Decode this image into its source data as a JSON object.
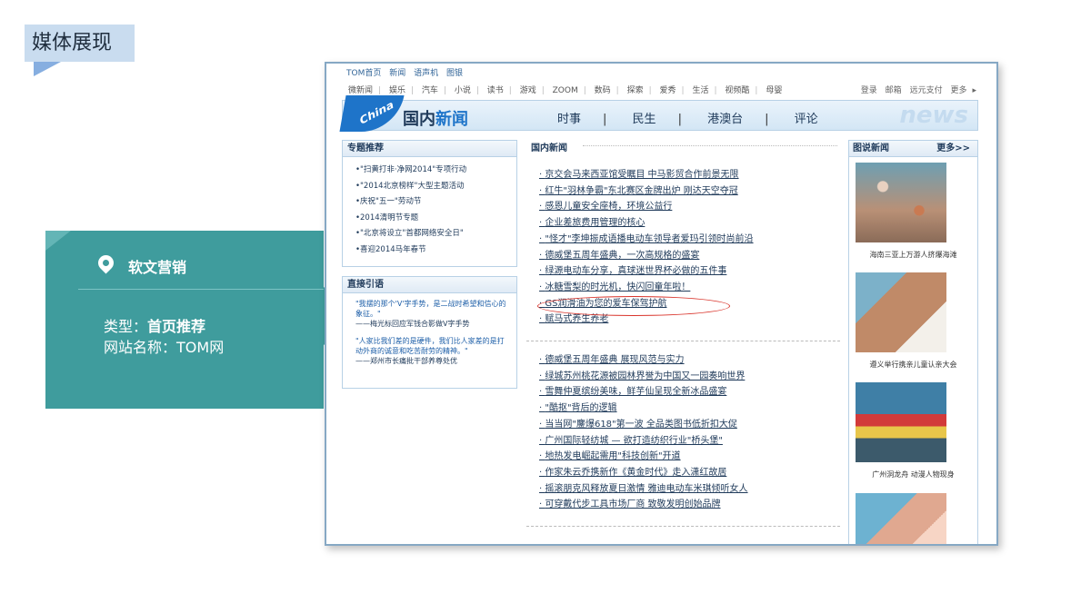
{
  "slide": {
    "title": "媒体展现",
    "panel": {
      "heading": "软文营销",
      "type_label": "类型：",
      "type_value": "首页推荐",
      "site_label": "网站名称：",
      "site_value": "TOM网"
    }
  },
  "site": {
    "topnav1": [
      "TOM首页",
      "新闻",
      "语声机",
      "图银"
    ],
    "topnav2": [
      "微新闻",
      "娱乐",
      "汽车",
      "小说",
      "读书",
      "游戏",
      "ZOOM",
      "数码",
      "探索",
      "爱秀",
      "生活",
      "视频酷",
      "母婴"
    ],
    "topright": [
      "登录",
      "邮箱",
      "远元支付",
      "更多"
    ],
    "banner": {
      "logo": "China",
      "title_a": "国内",
      "title_b": "新闻",
      "menu": [
        "时事",
        "民生",
        "港澳台",
        "评论"
      ],
      "watermark": "news"
    },
    "special": {
      "heading": "专题推荐",
      "items": [
        "•\"扫黄打非·净网2014\"专项行动",
        "•\"2014北京榜样\"大型主题活动",
        "•庆祝\"五一\"劳动节",
        "•2014清明节专题",
        "•\"北京将设立\"首都网络安全日\"",
        "•喜迎2014马年春节"
      ]
    },
    "quotes": {
      "heading": "直接引语",
      "q1": "\"我摆的那个'V'字手势，是二战时希望和信心的象征。\"",
      "a1": "——梅光标回应军钱合影做V字手势",
      "q2": "\"人家比我们差的是硬件，我们比人家差的是打动外商的诚意和吃苦耐劳的精神。\"",
      "a2": "——郑州市长痛批干部养尊处优"
    },
    "domestic": {
      "heading": "国内新闻",
      "list1": [
        "京交会马来西亚馆受瞩目 中马影贸合作前景无限",
        "红牛\"羽林争霸\"东北赛区金牌出炉 刚达天空夺冠",
        "感恩儿童安全座椅，环境公益行",
        "企业差旅费用管理的核心",
        "\"怪才\"李坤振成语播电动车领导者爱玛引领时尚前沿",
        "德威堡五周年盛典，一次高规格的盛宴",
        "绿源电动车分享，真球迷世界杯必做的五件事",
        "冰糖雪梨的时光机，快闪回童年啦！",
        "GS润滑油为您的爱车保驾护航",
        "赋马式养生养老"
      ],
      "list2": [
        "德威堡五周年盛典 展现风范与实力",
        "绿城苏州桃花源被园林界誉为中国又一园奏响世界",
        "雪舞仲夏缤纷美味，鲜芋仙呈现全新冰品盛宴",
        "\"酷抠\"背后的逻辑",
        "当当网\"鏖爆618\"第一波 全品类图书低折扣大促",
        "广州国际轻纺城 — 欲打造纺织行业\"桥头堡\"",
        "地热发电崛起需用\"科技创新\"开道",
        "作家朱云乔携新作《黄金时代》走入潇红故居",
        "摇滚朋克风释放夏日激情 雅迪电动车米琪倾听女人",
        "可穿戴代步工具市场厂商 致敬发明创始品牌"
      ]
    },
    "gallery": {
      "heading": "图说新闻",
      "more": "更多>>",
      "captions": [
        "海南三亚上万游人挤爆海滩",
        "遵义举行携亲儿童认亲大会",
        "广州洞龙舟 动漫人物现身"
      ]
    }
  }
}
